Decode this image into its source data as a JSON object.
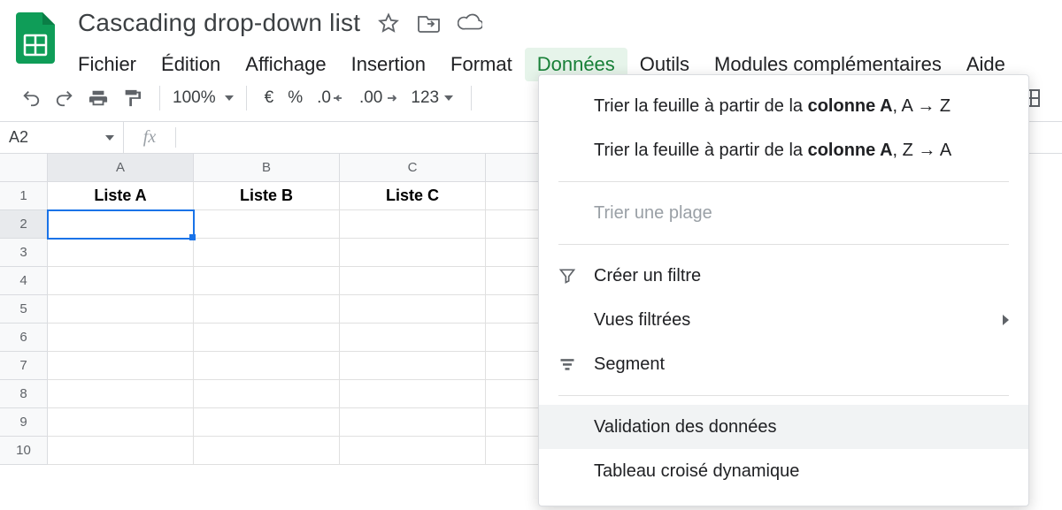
{
  "header": {
    "title": "Cascading drop-down list",
    "icons": {
      "star": "star",
      "folder": "move-to-folder",
      "cloud": "cloud-saved"
    }
  },
  "menubar": {
    "items": [
      "Fichier",
      "Édition",
      "Affichage",
      "Insertion",
      "Format",
      "Données",
      "Outils",
      "Modules complémentaires",
      "Aide"
    ],
    "active_index": 5
  },
  "toolbar": {
    "zoom": "100%",
    "currency_symbol": "€",
    "percent_symbol": "%",
    "dec_less": ".0",
    "dec_more": ".00",
    "number_format": "123"
  },
  "namebox": "A2",
  "formula": "",
  "columns": [
    "A",
    "B",
    "C",
    ""
  ],
  "row_count": 10,
  "cells": {
    "r1": [
      "Liste A",
      "Liste B",
      "Liste C",
      ""
    ]
  },
  "selected_cell": "A2",
  "dropdown": {
    "sort_prefix": "Trier la feuille à partir de la ",
    "sort_bold": "colonne A",
    "sort_az": ", A → Z",
    "sort_za": ", Z → A",
    "sort_range": "Trier une plage",
    "create_filter": "Créer un filtre",
    "filtered_views": "Vues filtrées",
    "slicer": "Segment",
    "data_validation": "Validation des données",
    "pivot": "Tableau croisé dynamique"
  }
}
